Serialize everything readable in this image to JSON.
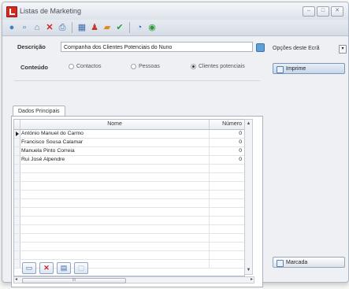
{
  "window": {
    "title": "Listas de Marketing",
    "controls": [
      "–",
      "□",
      "✕"
    ]
  },
  "toolbar": {
    "icons": [
      "circle-menu-icon",
      "new-document-icon",
      "open-icon",
      "delete-icon",
      "print-icon",
      "grid-icon",
      "people-icon",
      "export-icon",
      "check-icon",
      "refresh-icon",
      "help-icon"
    ]
  },
  "form": {
    "descricao_label": "Descrição",
    "descricao_value": "Companha dos Clientes Potenciais do Nuno",
    "conteudo_label": "Conteúdo",
    "options": [
      {
        "label": "Contactos",
        "selected": false
      },
      {
        "label": "Pessoas",
        "selected": false
      },
      {
        "label": "Clientes potenciais",
        "selected": true
      }
    ]
  },
  "tabs": {
    "active": "Dados Principais"
  },
  "grid": {
    "columns": {
      "nome": "Nome",
      "numero": "Número"
    },
    "rows": [
      {
        "nome": "António Manuel do Carmo",
        "numero": "0"
      },
      {
        "nome": "Francisco Sousa Calamar",
        "numero": "0"
      },
      {
        "nome": "Manuela Pinto Correia",
        "numero": "0"
      },
      {
        "nome": "Rui José Alpendre",
        "numero": "0"
      }
    ],
    "empty_rows": 12,
    "scroll_thumb_label": "III"
  },
  "side": {
    "title": "Opções deste Ecrã",
    "imprime_label": "Imprime",
    "marcada_label": "Marcada"
  }
}
